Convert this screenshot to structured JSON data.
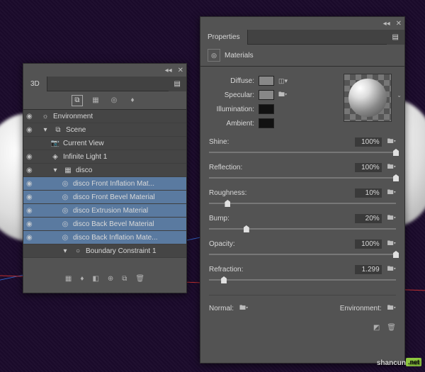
{
  "panel3d": {
    "title": "3D",
    "items": [
      {
        "icon": "☼",
        "label": "Environment",
        "indent": 0,
        "eye": true
      },
      {
        "icon": "⧉",
        "label": "Scene",
        "indent": 0,
        "eye": true,
        "expand": "▾"
      },
      {
        "icon": "■",
        "label": "Current View",
        "indent": 1,
        "eye": false,
        "iconCam": true
      },
      {
        "icon": "◈",
        "label": "Infinite Light 1",
        "indent": 1,
        "eye": true
      },
      {
        "icon": "▦",
        "label": "disco",
        "indent": 1,
        "eye": true,
        "expand": "▾"
      },
      {
        "icon": "◎",
        "label": "disco Front Inflation Mat...",
        "indent": 2,
        "eye": true,
        "sel": true
      },
      {
        "icon": "◎",
        "label": "disco Front Bevel Material",
        "indent": 2,
        "eye": true,
        "sel": true
      },
      {
        "icon": "◎",
        "label": "disco Extrusion Material",
        "indent": 2,
        "eye": true,
        "sel": true
      },
      {
        "icon": "◎",
        "label": "disco Back Bevel Material",
        "indent": 2,
        "eye": true,
        "sel": true
      },
      {
        "icon": "◎",
        "label": "disco Back Inflation Mate...",
        "indent": 2,
        "eye": true,
        "sel": true
      },
      {
        "icon": "○",
        "label": "Boundary Constraint 1",
        "indent": 2,
        "eye": false,
        "expand": "▾"
      }
    ]
  },
  "props": {
    "title": "Properties",
    "tab": "Materials",
    "swatches": {
      "diffuse": "Diffuse:",
      "specular": "Specular:",
      "illum": "Illumination:",
      "ambient": "Ambient:"
    },
    "sliders": [
      {
        "label": "Shine:",
        "value": "100%",
        "pos": 100
      },
      {
        "label": "Reflection:",
        "value": "100%",
        "pos": 100
      },
      {
        "label": "Roughness:",
        "value": "10%",
        "pos": 10
      },
      {
        "label": "Bump:",
        "value": "20%",
        "pos": 20
      },
      {
        "label": "Opacity:",
        "value": "100%",
        "pos": 100
      },
      {
        "label": "Refraction:",
        "value": "1.299",
        "pos": 8
      }
    ],
    "normal": "Normal:",
    "environment": "Environment:"
  },
  "watermark": {
    "text": "shancun",
    "suffix": ".net"
  }
}
